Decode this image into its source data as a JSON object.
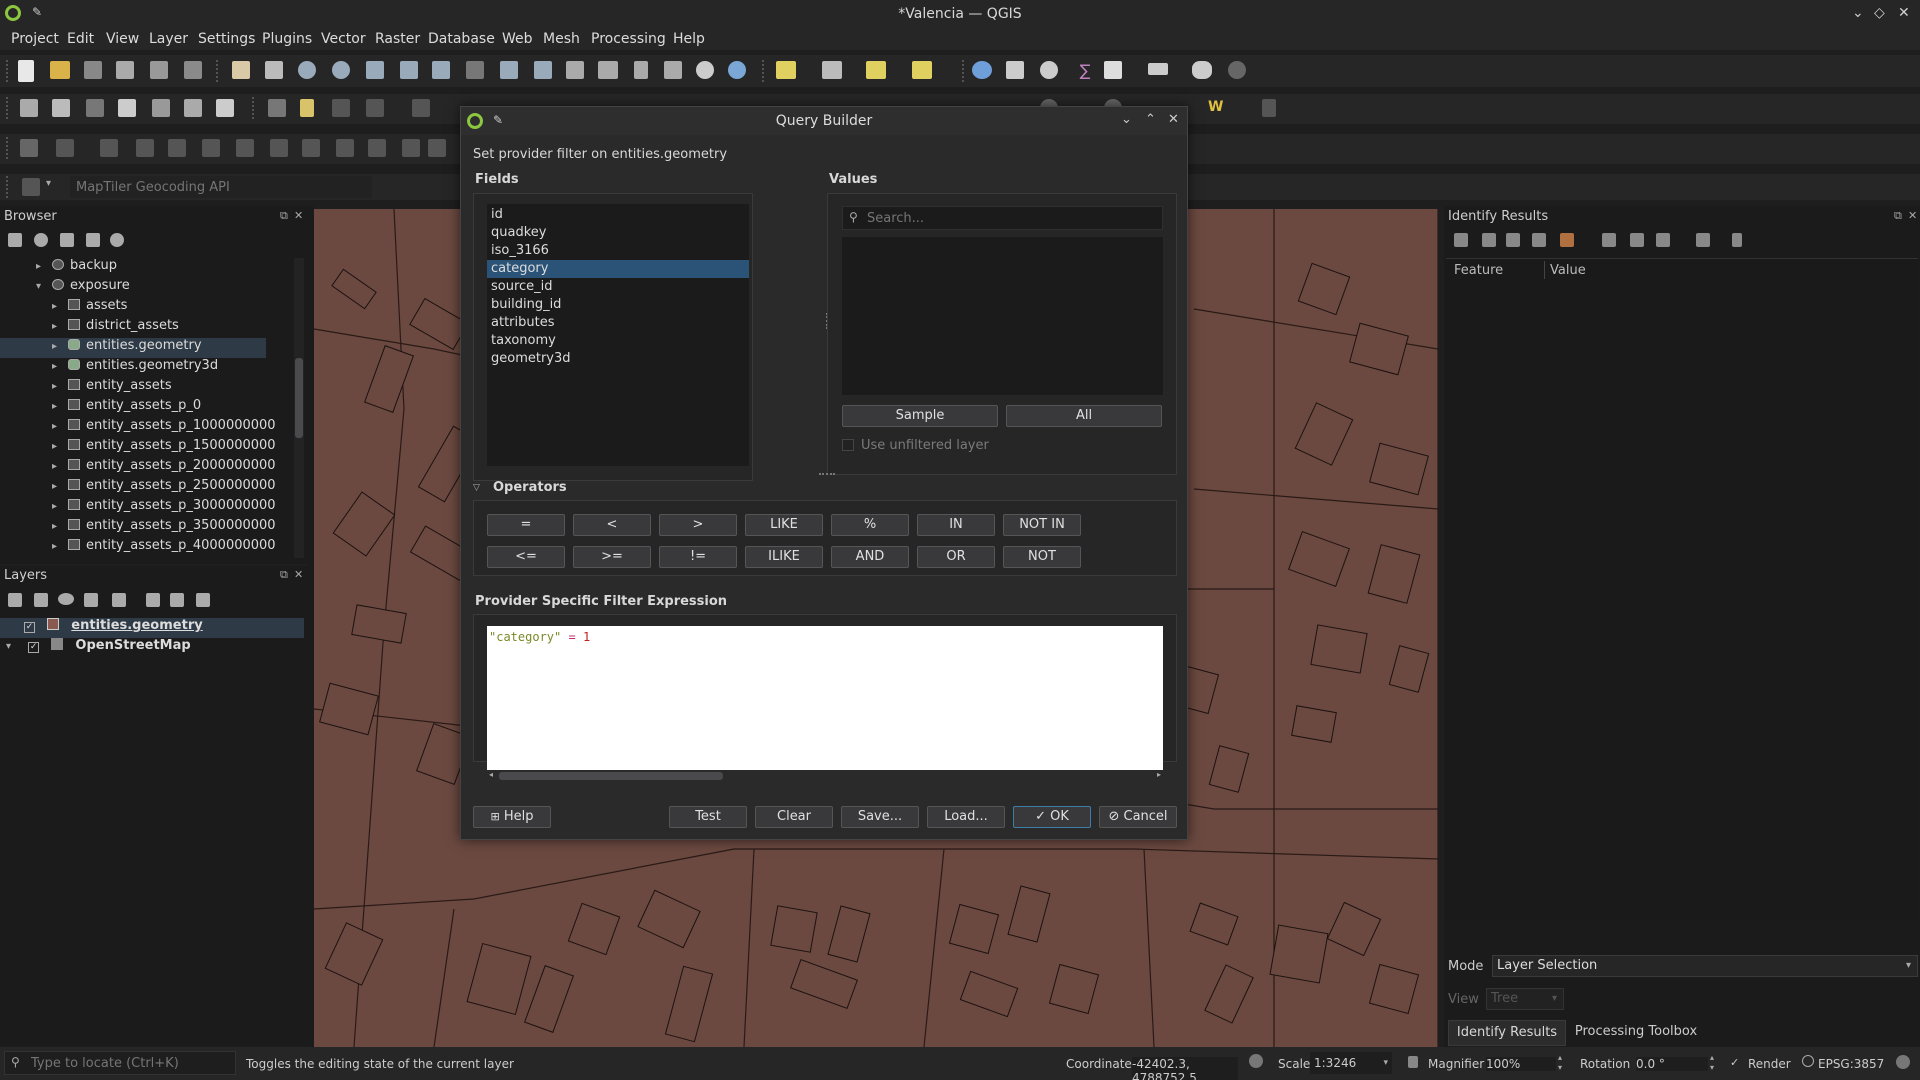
{
  "window": {
    "title": "*Valencia — QGIS",
    "controls": [
      "⌄",
      "◇",
      "✕"
    ]
  },
  "menu": [
    "Project",
    "Edit",
    "View",
    "Layer",
    "Settings",
    "Plugins",
    "Vector",
    "Raster",
    "Database",
    "Web",
    "Mesh",
    "Processing",
    "Help"
  ],
  "geocoder": {
    "placeholder": "MapTiler Geocoding API"
  },
  "browser": {
    "title": "Browser",
    "items": [
      {
        "label": "backup",
        "type": "schema",
        "indent": 1,
        "arrow": "▸"
      },
      {
        "label": "exposure",
        "type": "schema",
        "indent": 1,
        "arrow": "▾"
      },
      {
        "label": "assets",
        "type": "table",
        "indent": 2,
        "arrow": "▸"
      },
      {
        "label": "district_assets",
        "type": "table",
        "indent": 2,
        "arrow": "▸"
      },
      {
        "label": "entities.geometry",
        "type": "geom",
        "indent": 2,
        "arrow": "▸",
        "selected": true
      },
      {
        "label": "entities.geometry3d",
        "type": "geom",
        "indent": 2,
        "arrow": "▸"
      },
      {
        "label": "entity_assets",
        "type": "table",
        "indent": 2,
        "arrow": "▸"
      },
      {
        "label": "entity_assets_p_0",
        "type": "table",
        "indent": 2,
        "arrow": "▸"
      },
      {
        "label": "entity_assets_p_1000000000",
        "type": "table",
        "indent": 2,
        "arrow": "▸"
      },
      {
        "label": "entity_assets_p_1500000000",
        "type": "table",
        "indent": 2,
        "arrow": "▸"
      },
      {
        "label": "entity_assets_p_2000000000",
        "type": "table",
        "indent": 2,
        "arrow": "▸"
      },
      {
        "label": "entity_assets_p_2500000000",
        "type": "table",
        "indent": 2,
        "arrow": "▸"
      },
      {
        "label": "entity_assets_p_3000000000",
        "type": "table",
        "indent": 2,
        "arrow": "▸"
      },
      {
        "label": "entity_assets_p_3500000000",
        "type": "table",
        "indent": 2,
        "arrow": "▸"
      },
      {
        "label": "entity_assets_p_4000000000",
        "type": "table",
        "indent": 2,
        "arrow": "▸"
      }
    ]
  },
  "layers": {
    "title": "Layers",
    "items": [
      {
        "label": "entities.geometry",
        "checked": true,
        "selected": true
      },
      {
        "label": "OpenStreetMap",
        "checked": true,
        "selected": false
      }
    ]
  },
  "identify": {
    "title": "Identify Results",
    "columns": [
      "Feature",
      "Value"
    ],
    "mode_label": "Mode",
    "mode_value": "Layer Selection",
    "view_label": "View",
    "view_value": "Tree",
    "tabs": [
      "Identify Results",
      "Processing Toolbox"
    ]
  },
  "dialog": {
    "title": "Query Builder",
    "subtitle": "Set provider filter on entities.geometry",
    "fields_label": "Fields",
    "fields": [
      "id",
      "quadkey",
      "iso_3166",
      "category",
      "source_id",
      "building_id",
      "attributes",
      "taxonomy",
      "geometry3d"
    ],
    "selected_field": "category",
    "values_label": "Values",
    "search_placeholder": "Search...",
    "sample_btn": "Sample",
    "all_btn": "All",
    "unfiltered_label": "Use unfiltered layer",
    "operators_label": "Operators",
    "operators_row1": [
      "=",
      "<",
      ">",
      "LIKE",
      "%",
      "IN",
      "NOT IN"
    ],
    "operators_row2": [
      "<=",
      ">=",
      "!=",
      "ILIKE",
      "AND",
      "OR",
      "NOT"
    ],
    "expression_label": "Provider Specific Filter Expression",
    "expression": {
      "field": "\"category\"",
      "op": "=",
      "value": "1"
    },
    "buttons": {
      "help": "Help",
      "test": "Test",
      "clear": "Clear",
      "save": "Save...",
      "load": "Load...",
      "ok": "OK",
      "cancel": "Cancel"
    }
  },
  "status": {
    "locator_placeholder": "Type to locate (Ctrl+K)",
    "message": "Toggles the editing state of the current layer",
    "coordinate_label": "Coordinate",
    "coordinate": "-42402.3, 4788752.5",
    "scale_label": "Scale",
    "scale": "1:3246",
    "magnifier_label": "Magnifier",
    "magnifier": "100%",
    "rotation_label": "Rotation",
    "rotation": "0.0 °",
    "render_label": "Render",
    "crs": "EPSG:3857"
  },
  "colors": {
    "map": "#6b4940",
    "selection": "#2b5377",
    "accent": "#3e7ea6"
  }
}
